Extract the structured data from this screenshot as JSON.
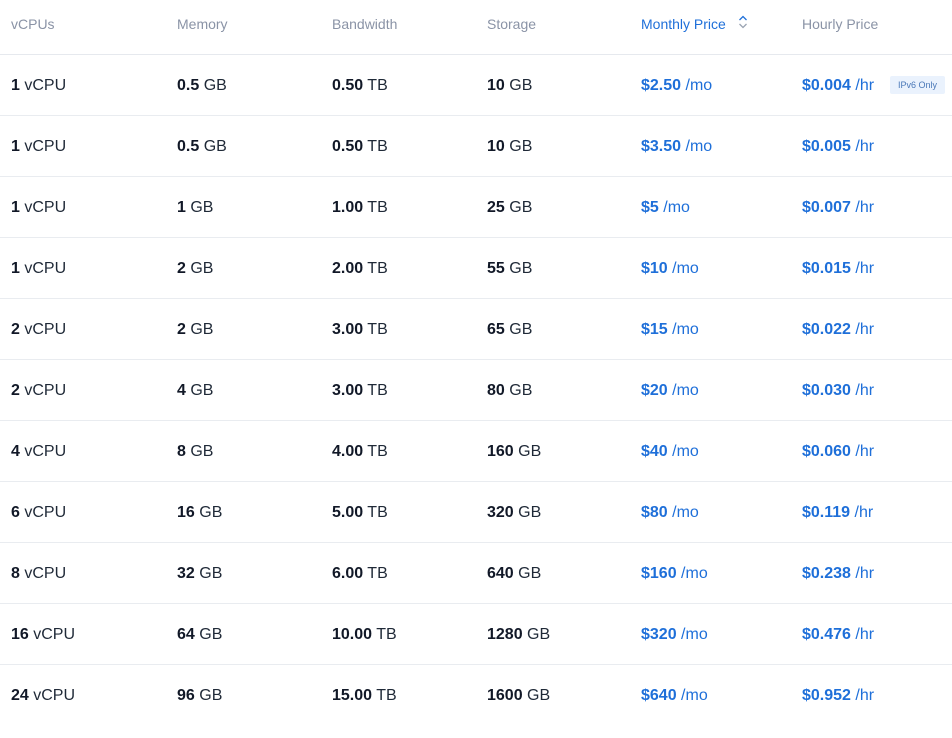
{
  "headers": {
    "vcpus": "vCPUs",
    "memory": "Memory",
    "bandwidth": "Bandwidth",
    "storage": "Storage",
    "monthly_price": "Monthly Price",
    "hourly_price": "Hourly Price",
    "sort_icon": "sort-up-down-icon"
  },
  "units": {
    "vcpu": "vCPU",
    "gb": "GB",
    "tb": "TB",
    "mo": "/mo",
    "hr": "/hr"
  },
  "badge": "IPv6 Only",
  "colors": {
    "accent": "#1e6fd9",
    "badge_bg": "#eaf2fd",
    "header_text": "#8a93a6"
  },
  "rows": [
    {
      "vcpus": "1",
      "memory": "0.5",
      "bandwidth": "0.50",
      "storage": "10",
      "monthly": "$2.50",
      "hourly": "$0.004",
      "ipv6_only": true
    },
    {
      "vcpus": "1",
      "memory": "0.5",
      "bandwidth": "0.50",
      "storage": "10",
      "monthly": "$3.50",
      "hourly": "$0.005",
      "ipv6_only": false
    },
    {
      "vcpus": "1",
      "memory": "1",
      "bandwidth": "1.00",
      "storage": "25",
      "monthly": "$5",
      "hourly": "$0.007",
      "ipv6_only": false
    },
    {
      "vcpus": "1",
      "memory": "2",
      "bandwidth": "2.00",
      "storage": "55",
      "monthly": "$10",
      "hourly": "$0.015",
      "ipv6_only": false
    },
    {
      "vcpus": "2",
      "memory": "2",
      "bandwidth": "3.00",
      "storage": "65",
      "monthly": "$15",
      "hourly": "$0.022",
      "ipv6_only": false
    },
    {
      "vcpus": "2",
      "memory": "4",
      "bandwidth": "3.00",
      "storage": "80",
      "monthly": "$20",
      "hourly": "$0.030",
      "ipv6_only": false
    },
    {
      "vcpus": "4",
      "memory": "8",
      "bandwidth": "4.00",
      "storage": "160",
      "monthly": "$40",
      "hourly": "$0.060",
      "ipv6_only": false
    },
    {
      "vcpus": "6",
      "memory": "16",
      "bandwidth": "5.00",
      "storage": "320",
      "monthly": "$80",
      "hourly": "$0.119",
      "ipv6_only": false
    },
    {
      "vcpus": "8",
      "memory": "32",
      "bandwidth": "6.00",
      "storage": "640",
      "monthly": "$160",
      "hourly": "$0.238",
      "ipv6_only": false
    },
    {
      "vcpus": "16",
      "memory": "64",
      "bandwidth": "10.00",
      "storage": "1280",
      "monthly": "$320",
      "hourly": "$0.476",
      "ipv6_only": false
    },
    {
      "vcpus": "24",
      "memory": "96",
      "bandwidth": "15.00",
      "storage": "1600",
      "monthly": "$640",
      "hourly": "$0.952",
      "ipv6_only": false
    }
  ]
}
